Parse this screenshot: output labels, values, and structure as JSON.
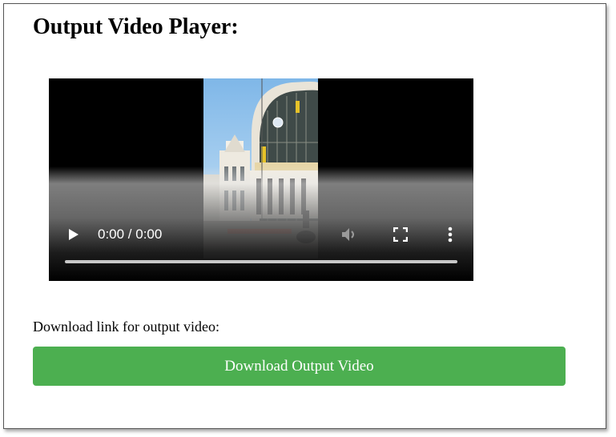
{
  "page": {
    "title": "Output Video Player:"
  },
  "video": {
    "time_display": "0:00 / 0:00",
    "progress": 0,
    "icons": {
      "play": "play-icon",
      "mute": "volume-muted-icon",
      "fullscreen": "fullscreen-icon",
      "more": "more-options-icon"
    }
  },
  "download": {
    "label": "Download link for output video:",
    "button_label": "Download Output Video",
    "button_color": "#4caf50"
  }
}
